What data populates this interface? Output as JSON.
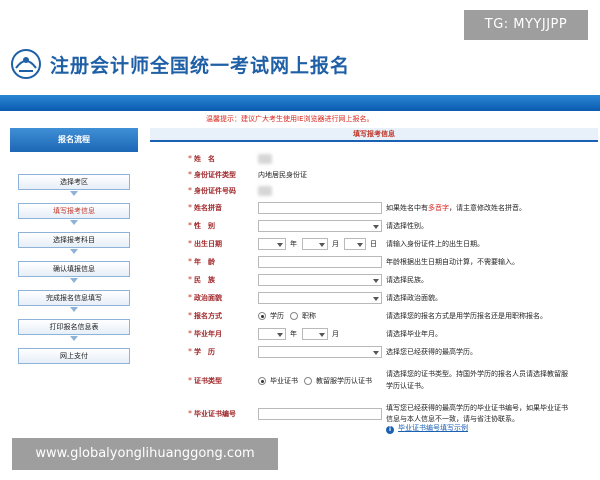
{
  "watermarks": {
    "top": "TG: MYYJJPP",
    "bottom": "www.globalyonglihuanggong.com"
  },
  "header": {
    "title": "注册会计师全国统一考试网上报名"
  },
  "notice": "温馨提示：建议广大考生使用IE浏览器进行网上报名。",
  "sidebar": {
    "title": "报名流程",
    "steps": [
      {
        "label": "选择考区"
      },
      {
        "label": "填写报考信息"
      },
      {
        "label": "选择报考科目"
      },
      {
        "label": "确认填报信息"
      },
      {
        "label": "完成报名信息填写"
      },
      {
        "label": "打印报名信息表"
      },
      {
        "label": "网上支付"
      }
    ]
  },
  "form": {
    "title": "填写报考信息",
    "name_label": "姓　名",
    "id_type_label": "身份证件类型",
    "id_type_value": "内地居民身份证",
    "id_no_label": "身份证件号码",
    "pinyin_label": "姓名拼音",
    "pinyin_hint_a": "如果姓名中有",
    "pinyin_hint_red": "多音字",
    "pinyin_hint_b": "，请主意修改姓名拼音。",
    "gender_label": "性　别",
    "gender_hint": "请选择性别。",
    "birth_label": "出生日期",
    "birth_year_unit": "年",
    "birth_month_unit": "月",
    "birth_day_unit": "日",
    "birth_hint": "请输入身份证件上的出生日期。",
    "age_label": "年　龄",
    "age_hint": "年龄根据出生日期自动计算，不需要输入。",
    "ethnic_label": "民　族",
    "ethnic_hint": "请选择民族。",
    "political_label": "政治面貌",
    "political_hint": "请选择政治面貌。",
    "apply_mode_label": "报名方式",
    "apply_mode_options": [
      "学历",
      "职称"
    ],
    "apply_mode_hint": "请选择您的报名方式是用学历报名还是用职称报名。",
    "grad_date_label": "毕业年月",
    "grad_year_unit": "年",
    "grad_month_unit": "月",
    "grad_date_hint": "请选择毕业年月。",
    "education_label": "学　历",
    "education_hint": "选择您已经获得的最高学历。",
    "cert_type_label": "证书类型",
    "cert_type_options": [
      "毕业证书",
      "教留服学历认证书"
    ],
    "cert_type_hint_1": "请选择您的证书类型。持国外学历的报名人员请选择教留服",
    "cert_type_hint_2": "学历认证书。",
    "cert_no_label": "毕业证书编号",
    "cert_no_hint_1": "填写您已经获得的最高学历的毕业证书编号，如果毕业证书",
    "cert_no_hint_2": "信息与本人信息不一致，请与省注协联系。",
    "cert_no_link": "毕业证书编号填写示例"
  },
  "colors": {
    "brand_blue": "#1f5fa6",
    "bar_blue": "#0b5bb0",
    "label_red": "#a0282a",
    "notice_red": "#d8261c"
  }
}
